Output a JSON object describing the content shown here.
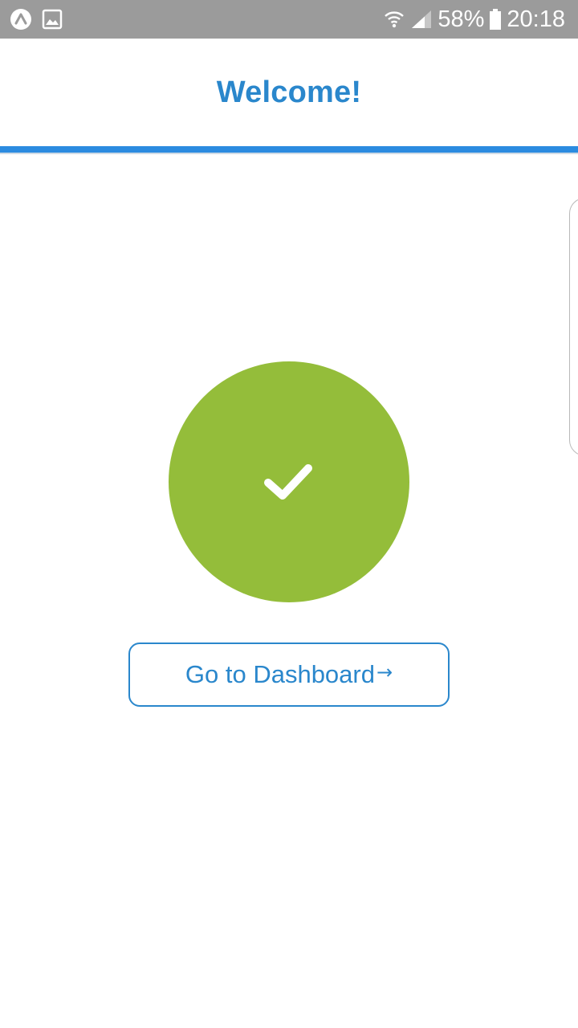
{
  "status_bar": {
    "battery_text": "58%",
    "time": "20:18",
    "icons": [
      "app-logo-icon",
      "image-icon",
      "wifi-icon",
      "signal-icon",
      "battery-icon"
    ]
  },
  "header": {
    "title": "Welcome!"
  },
  "success": {
    "icon": "checkmark-icon",
    "color": "#94bd3a"
  },
  "dashboard_button": {
    "label": "Go to Dashboard",
    "icon": "arrow-right-icon",
    "arrow": "→"
  },
  "colors": {
    "accent": "#2a87cc",
    "rule": "#2b8be0",
    "status_bar": "#9b9b9b",
    "success": "#94bd3a"
  }
}
